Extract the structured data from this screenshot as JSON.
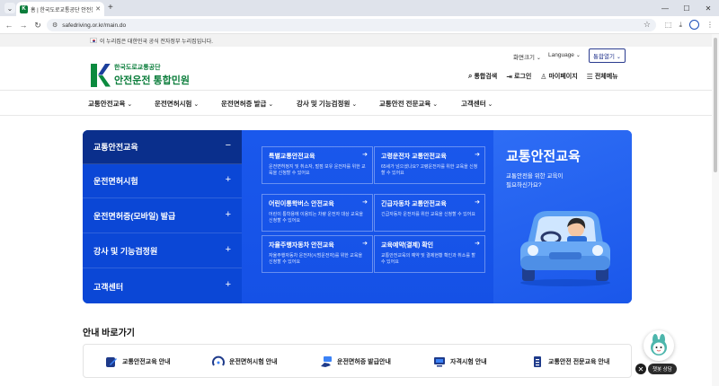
{
  "browser": {
    "tab_title": "홈 | 한국도로교통공단 안전운전",
    "url": "safedriving.or.kr/main.do"
  },
  "gov_notice": "이 누리집은 대한민국 공식 전자정부 누리집입니다.",
  "utility": {
    "font_size": "화면크기",
    "language": "Language",
    "integrated": "통합열기"
  },
  "logo": {
    "org": "한국도로교통공단",
    "service": "안전운전 통합민원"
  },
  "header_links": [
    "통합검색",
    "로그인",
    "마이페이지",
    "전체메뉴"
  ],
  "gnb": [
    "교통안전교육",
    "운전면허시험",
    "운전면허증 발급",
    "강사 및 기능검정원",
    "교통안전 전문교육",
    "고객센터"
  ],
  "side_menu": [
    {
      "label": "교통안전교육",
      "sign": "−"
    },
    {
      "label": "운전면허시험",
      "sign": "+"
    },
    {
      "label": "운전면허증(모바일) 발급",
      "sign": "+"
    },
    {
      "label": "강사 및 기능검정원",
      "sign": "+"
    },
    {
      "label": "고객센터",
      "sign": "+"
    }
  ],
  "link_cards": [
    {
      "title": "특별교통안전교육",
      "desc": "운전면허정지 및 취소자, 벌점 보유 운전자를 위한 교육을 신청할 수 있어요"
    },
    {
      "title": "고령운전자 교통안전교육",
      "desc": "65세가 넘으셨나요? 고령운전자를 위한 교육을 신청할 수 있어요"
    },
    {
      "title": "어린이통학버스 안전교육",
      "desc": "어린이 통학용에 이용되는 차량 운전자 대상 교육을 신청할 수 있어요"
    },
    {
      "title": "긴급자동차 교통안전교육",
      "desc": "긴급자동차 운전자를 위한 교육을 신청할 수 있어요"
    },
    {
      "title": "자율주행자동차 안전교육",
      "desc": "자율주행자동차 운전자(시범운전자)를 위한 교육을 신청할 수 있어요"
    },
    {
      "title": "교육예약(결제) 확인",
      "desc": "교통안전교육의 예약 및 결제현황 확인과 취소를 할 수 있어요"
    }
  ],
  "promo": {
    "title": "교통안전교육",
    "sub1": "교통안전을 위한 교육이",
    "sub2": "필요하신가요?"
  },
  "quick": {
    "title": "안내 바로가기",
    "items": [
      "교통안전교육 안내",
      "운전면허시험 안내",
      "운전면허증 발급안내",
      "자격시험 안내",
      "교통안전 전문교육 안내"
    ]
  },
  "chatbot_label": "챗봇 상담",
  "colors": {
    "brand_green": "#0b7d3b",
    "brand_blue": "#1551e6",
    "active_navy": "#0a2f8c"
  }
}
